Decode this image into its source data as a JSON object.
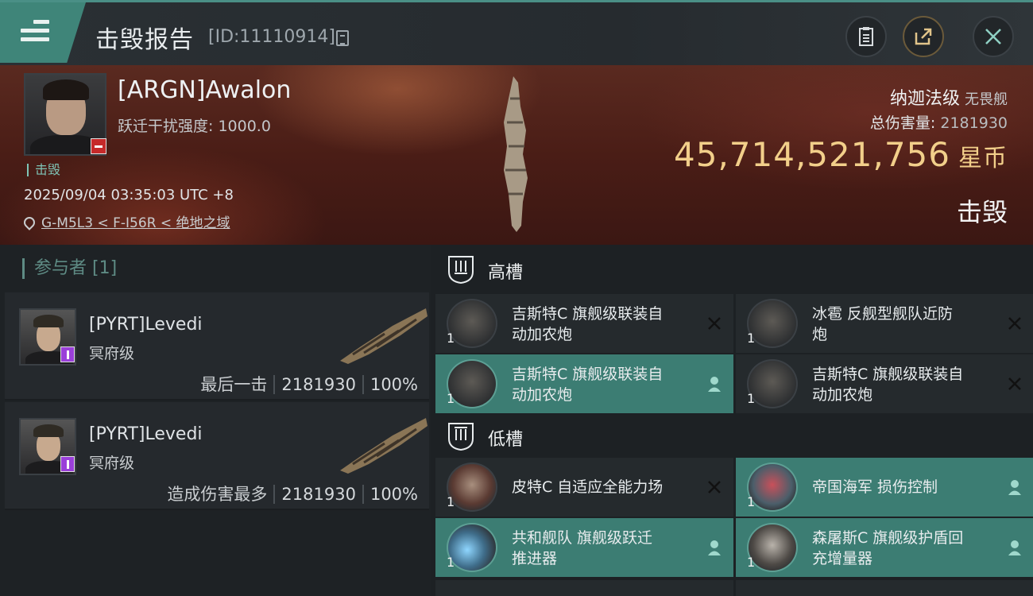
{
  "header": {
    "title": "击毁报告",
    "id_text": "[ID:11110914]"
  },
  "victim": {
    "name": "[ARGN]Awalon",
    "stat": "跃迁干扰强度: 1000.0",
    "status_tag": "击毁",
    "datetime": "2025/09/04 03:35:03 UTC +8",
    "location": "G-M5L3 < F-I56R < 绝地之域",
    "ship_class": "纳迦法级",
    "ship_type": "无畏舰",
    "total_damage_label": "总伤害量:",
    "total_damage": "2181930",
    "isk_value": "45,714,521,756",
    "isk_unit": "星币",
    "result": "击毁"
  },
  "participants": {
    "header": "参与者 [1]",
    "rows": [
      {
        "name": "[PYRT]Levedi",
        "ship": "冥府级",
        "label": "最后一击",
        "damage": "2181930",
        "percent": "100%"
      },
      {
        "name": "[PYRT]Levedi",
        "ship": "冥府级",
        "label": "造成伤害最多",
        "damage": "2181930",
        "percent": "100%"
      }
    ]
  },
  "fitting": {
    "high_slots_label": "高槽",
    "low_slots_label": "低槽",
    "high": [
      {
        "qty": "1",
        "line1": "吉斯特C 旗舰级联装自",
        "line2": "动加农炮",
        "state": "destroyed"
      },
      {
        "qty": "1",
        "line1": "冰雹 反舰型舰队近防",
        "line2": "炮",
        "state": "destroyed"
      },
      {
        "qty": "1",
        "line1": "吉斯特C 旗舰级联装自",
        "line2": "动加农炮",
        "state": "dropped"
      },
      {
        "qty": "1",
        "line1": "吉斯特C 旗舰级联装自",
        "line2": "动加农炮",
        "state": "destroyed"
      }
    ],
    "low": [
      {
        "qty": "1",
        "line1": "皮特C 自适应全能力场",
        "line2": "",
        "state": "destroyed"
      },
      {
        "qty": "1",
        "line1": "帝国海军 损伤控制",
        "line2": "",
        "state": "dropped"
      },
      {
        "qty": "1",
        "line1": "共和舰队 旗舰级跃迁",
        "line2": "推进器",
        "state": "dropped"
      },
      {
        "qty": "1",
        "line1": "森屠斯C 旗舰级护盾回",
        "line2": "充增量器",
        "state": "dropped"
      }
    ]
  },
  "colors": {
    "accent": "#3c7d73",
    "isk": "#f2cf8a",
    "status_red": "#c62a2a",
    "corp_purple": "#9a3fd9"
  }
}
